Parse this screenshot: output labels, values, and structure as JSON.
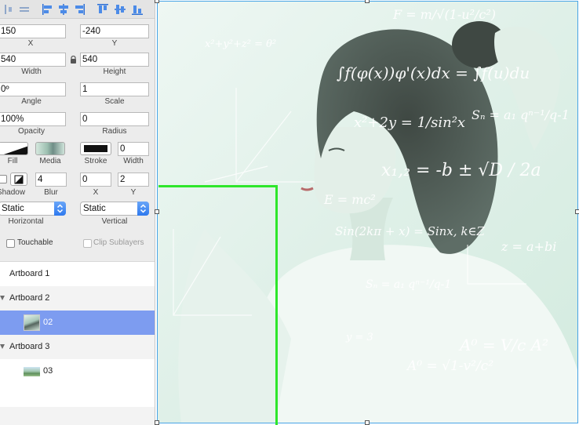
{
  "inspector": {
    "x": {
      "value": "150",
      "label": "X"
    },
    "y": {
      "value": "-240",
      "label": "Y"
    },
    "width": {
      "value": "540",
      "label": "Width"
    },
    "height": {
      "value": "540",
      "label": "Height"
    },
    "angle": {
      "value": "0º",
      "label": "Angle"
    },
    "scale": {
      "value": "1",
      "label": "Scale"
    },
    "opacity": {
      "value": "100%",
      "label": "Opacity"
    },
    "radius": {
      "value": "0",
      "label": "Radius"
    },
    "fill_label": "Fill",
    "media_label": "Media",
    "stroke_label": "Stroke",
    "stroke_width": {
      "value": "0",
      "label": "Width"
    },
    "shadow_label": "Shadow",
    "blur": {
      "value": "4",
      "label": "Blur"
    },
    "shadow_x": {
      "value": "0",
      "label": "X"
    },
    "shadow_y": {
      "value": "2",
      "label": "Y"
    },
    "horizontal": {
      "value": "Static",
      "label": "Horizontal"
    },
    "vertical": {
      "value": "Static",
      "label": "Vertical"
    },
    "touchable_label": "Touchable",
    "clip_sublayers_label": "Clip Sublayers"
  },
  "layers": [
    {
      "name": "Artboard 1",
      "expanded": false
    },
    {
      "name": "Artboard 2",
      "expanded": true
    },
    {
      "name": "02",
      "selected": true
    },
    {
      "name": "Artboard 3",
      "expanded": true
    },
    {
      "name": "03"
    }
  ],
  "canvas": {
    "formulas": [
      "F = m/√(1-u²/c²)",
      "∫f(φ(x))φ'(x)dx = ∫f(u)du",
      "x²+2y = 1/sin²x",
      "Sₙ = a₁ qⁿ⁻¹/q-1",
      "x₁,₂ = -b ± √D / 2a",
      "E = mc²",
      "Sin(2kπ + x) = Sinx, k∈Z",
      "z = a+bi",
      "Sₙ = a₁ qⁿ⁻¹/q-1",
      "y = 3",
      "A⁰ = V/c A²",
      "A⁰ = √1-v²/c²",
      "x²+y²+z² = θ²"
    ]
  },
  "colors": {
    "selection": "#7d9cf0",
    "guide": "#2ee62b",
    "frame": "#47a4e6",
    "select_arrow": "#2e79ee"
  },
  "icons": [
    "align-left-icon",
    "align-center-h-icon",
    "align-right-icon",
    "align-top-icon",
    "align-middle-icon",
    "align-bottom-icon",
    "distribute-h-icon",
    "distribute-v-icon",
    "lock-icon",
    "chevron-updown-icon",
    "disclosure-triangle-icon"
  ]
}
